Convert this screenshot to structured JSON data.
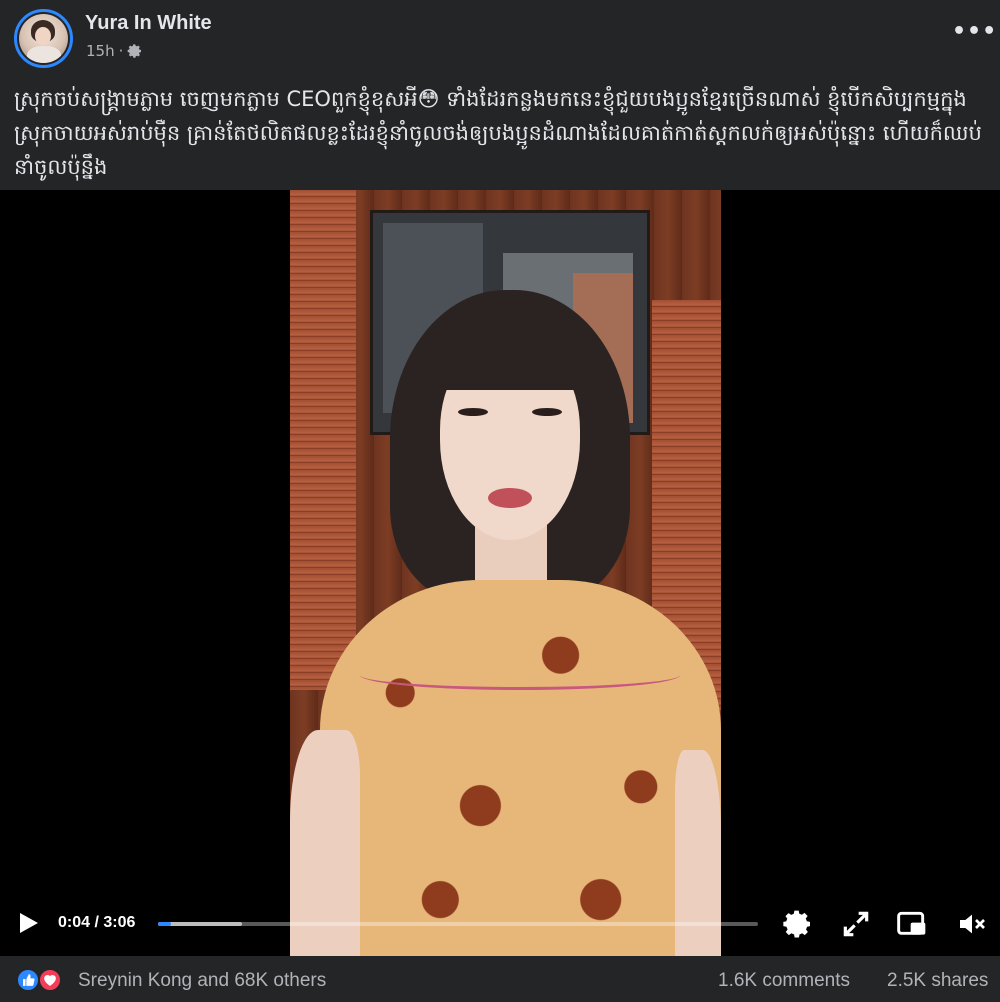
{
  "post": {
    "author": "Yura In White",
    "time": "15h",
    "privacy_icon": "gear-icon",
    "more_label": "•••",
    "caption": "ស្រុកចប់សង្គ្រាមភ្លាម ចេញមកភ្លាម CEOពួកខ្ញុំខុសអី😳 ទាំងដែរកន្លងមកនេះខ្ញុំជួយបងប្អូនខ្មែរច្រើនណាស់ ខ្ញុំបើកសិប្បកម្មក្នុងស្រុកចាយអស់រាប់ម៉ឺន គ្រាន់តែថលិតផលខ្លះដែរខ្ញុំនាំចូលចង់ឲ្យបងប្អូនដំណាងដែលគាត់កាត់ស្តកលក់ឲ្យអស់ប៉ុន្នោះ ហើយក៏ឈប់នាំចូលប៉ុន្នឹង"
  },
  "video": {
    "current_time": "0:04",
    "duration": "3:06",
    "time_separator": "/",
    "progress_fraction": 0.022,
    "buffered_fraction": 0.14,
    "icons": [
      "play-icon",
      "settings-icon",
      "fullscreen-icon",
      "picture-in-picture-icon",
      "volume-muted-icon"
    ]
  },
  "footer": {
    "reactions_text": "Sreynin Kong and 68K others",
    "comments": "1.6K comments",
    "shares": "2.5K shares"
  },
  "colors": {
    "background": "#242526",
    "accent": "#2d88ff",
    "text_primary": "#e4e6eb",
    "text_secondary": "#b0b3b8",
    "love": "#f33e58"
  }
}
